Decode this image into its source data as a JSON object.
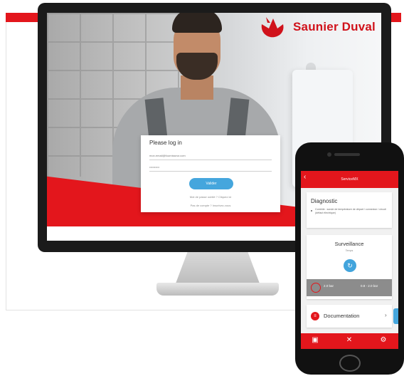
{
  "brand": {
    "name": "Saunier Duval",
    "accent_color": "#e3161c",
    "button_color": "#45a6dd"
  },
  "desktop": {
    "login": {
      "title": "Please log in",
      "email_placeholder": "mon.email@fournisseur.com",
      "password_placeholder": "••••••••••",
      "submit_label": "Valider",
      "forgot_link": "Mot de passe oublié ? Cliquez ici",
      "signup_text": "Pas de compte ? Inscrivez-vous"
    }
  },
  "mobile": {
    "header": {
      "back_icon": "chevron-left-icon",
      "title": "ServiceMX"
    },
    "diagnostic": {
      "title": "Diagnostic",
      "text": "Contrôle : sonde de température de départ / connexion / circuit (défaut électrique)"
    },
    "surveillance": {
      "title": "Surveillance",
      "subtitle": "Temps",
      "refresh_icon": "refresh-icon",
      "gauge_icon": "gauge-icon",
      "value_left": "2.0 bar",
      "value_right": "0.8 - 2.0 bar"
    },
    "documentation": {
      "label": "Documentation",
      "icon": "document-icon",
      "chevron": "›"
    },
    "bottom_nav": [
      {
        "name": "dashboard-icon",
        "glyph": "▣"
      },
      {
        "name": "tools-icon",
        "glyph": "✕"
      },
      {
        "name": "settings-icon",
        "glyph": "⚙"
      }
    ]
  }
}
